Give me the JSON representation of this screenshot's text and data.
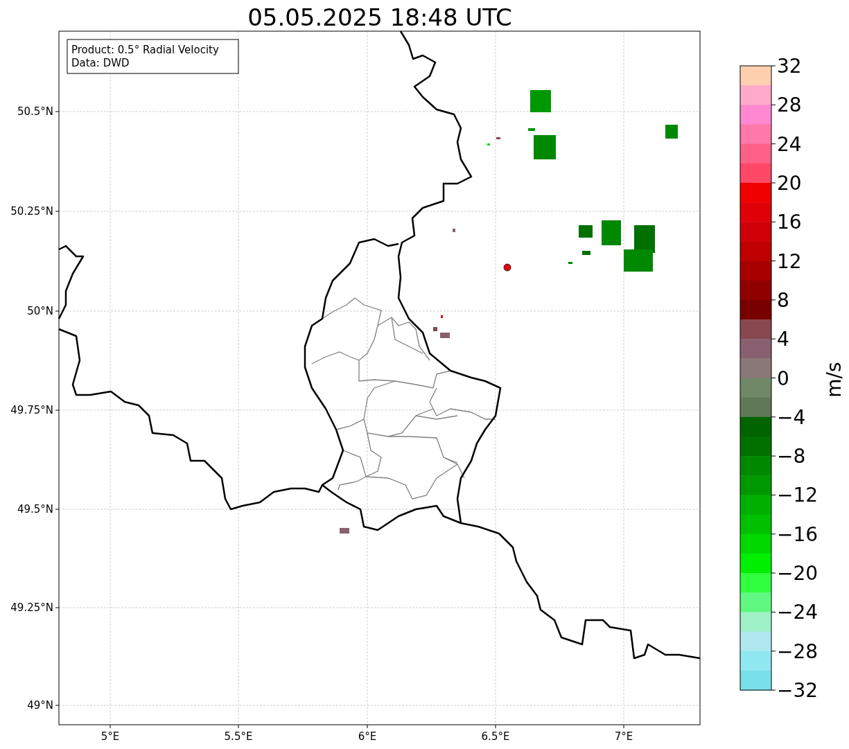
{
  "title": "05.05.2025 18:48 UTC",
  "info_box": [
    "Product: 0.5° Radial Velocity",
    "Data: DWD"
  ],
  "map": {
    "lat_labels": [
      "50.5°N",
      "50.25°N",
      "50°N",
      "49.75°N",
      "49.5°N",
      "49.25°N",
      "49°N"
    ],
    "lon_labels": [
      "5°E",
      "5.5°E",
      "6°E",
      "6.5°E",
      "7°E"
    ]
  },
  "colorbar": {
    "label": "m/s",
    "tick_labels": [
      "32",
      "28",
      "24",
      "20",
      "16",
      "12",
      "8",
      "4",
      "0",
      "−4",
      "−8",
      "−12",
      "−16",
      "−20",
      "−24",
      "−28",
      "−32"
    ],
    "bands": [
      {
        "color": "#ffd0b0"
      },
      {
        "color": "#ffaac8"
      },
      {
        "color": "#ff88d0"
      },
      {
        "color": "#ff78a8"
      },
      {
        "color": "#ff6088"
      },
      {
        "color": "#ff4868"
      },
      {
        "color": "#f00000"
      },
      {
        "color": "#e00008"
      },
      {
        "color": "#d00008"
      },
      {
        "color": "#c00000"
      },
      {
        "color": "#a80000"
      },
      {
        "color": "#900000"
      },
      {
        "color": "#780000"
      },
      {
        "color": "#884850"
      },
      {
        "color": "#886070"
      },
      {
        "color": "#8a7878"
      },
      {
        "color": "#708868"
      },
      {
        "color": "#607858"
      },
      {
        "color": "#006400"
      },
      {
        "color": "#007000"
      },
      {
        "color": "#008800"
      },
      {
        "color": "#009800"
      },
      {
        "color": "#00b000"
      },
      {
        "color": "#00c000"
      },
      {
        "color": "#00d800"
      },
      {
        "color": "#00f000"
      },
      {
        "color": "#30ff40"
      },
      {
        "color": "#60f880"
      },
      {
        "color": "#a0f0c8"
      },
      {
        "color": "#b0e8f0"
      },
      {
        "color": "#90e8f0"
      },
      {
        "color": "#78e0e8"
      }
    ]
  }
}
